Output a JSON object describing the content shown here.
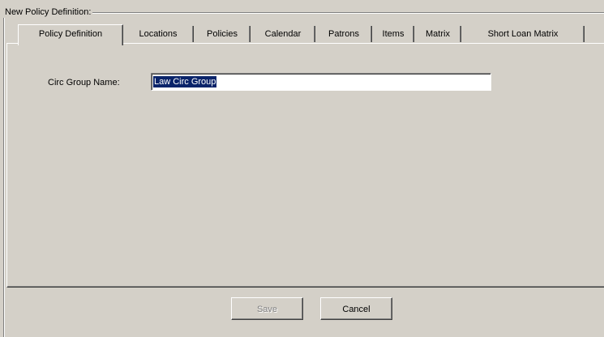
{
  "group": {
    "title": "New Policy Definition:"
  },
  "tabs": [
    {
      "label": "Policy Definition",
      "active": true
    },
    {
      "label": "Locations",
      "active": false
    },
    {
      "label": "Policies",
      "active": false
    },
    {
      "label": "Calendar",
      "active": false
    },
    {
      "label": "Patrons",
      "active": false
    },
    {
      "label": "Items",
      "active": false
    },
    {
      "label": "Matrix",
      "active": false
    },
    {
      "label": "Short Loan Matrix",
      "active": false
    }
  ],
  "form": {
    "circ_group_label": "Circ Group Name:",
    "circ_group_value": "Law Circ Group"
  },
  "buttons": {
    "save_label": "Save",
    "save_enabled": false,
    "cancel_label": "Cancel"
  },
  "colors": {
    "face": "#d4d0c8",
    "selection": "#0a246a"
  }
}
